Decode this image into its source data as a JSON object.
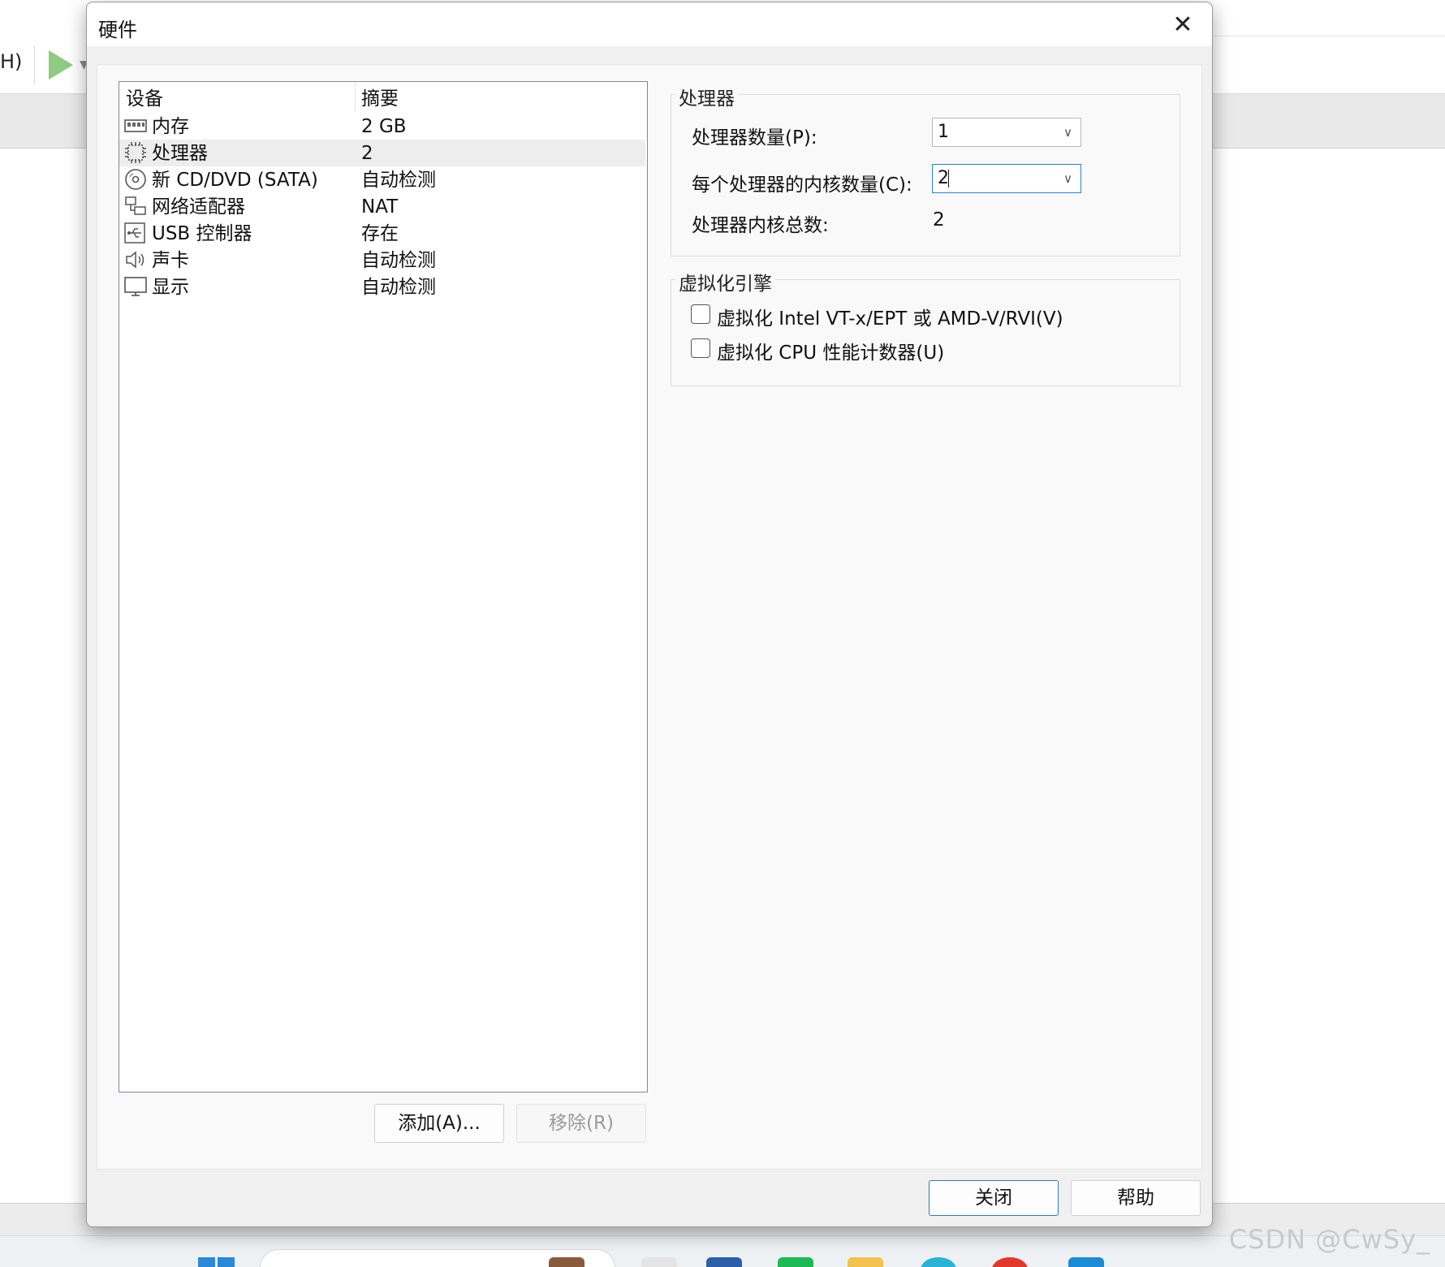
{
  "background": {
    "menu_fragment": "H)",
    "watermark": "CSDN @CwSy_"
  },
  "dialog": {
    "title": "硬件",
    "close_glyph": "✕"
  },
  "device_list": {
    "columns": {
      "device": "设备",
      "summary": "摘要"
    },
    "rows": [
      {
        "icon": "memory-icon",
        "name": "内存",
        "summary": "2 GB",
        "selected": false
      },
      {
        "icon": "processor-icon",
        "name": "处理器",
        "summary": "2",
        "selected": true
      },
      {
        "icon": "cd-dvd-icon",
        "name": "新 CD/DVD (SATA)",
        "summary": "自动检测",
        "selected": false
      },
      {
        "icon": "network-adapter-icon",
        "name": "网络适配器",
        "summary": "NAT",
        "selected": false
      },
      {
        "icon": "usb-icon",
        "name": "USB 控制器",
        "summary": "存在",
        "selected": false
      },
      {
        "icon": "speaker-icon",
        "name": "声卡",
        "summary": "自动检测",
        "selected": false
      },
      {
        "icon": "monitor-icon",
        "name": "显示",
        "summary": "自动检测",
        "selected": false
      }
    ],
    "add_button": "添加(A)...",
    "remove_button": "移除(R)"
  },
  "processor": {
    "group_title": "处理器",
    "count_label": "处理器数量(P):",
    "count_value": "1",
    "cores_label": "每个处理器的内核数量(C):",
    "cores_value": "2",
    "total_label": "处理器内核总数:",
    "total_value": "2"
  },
  "virtualization": {
    "group_title": "虚拟化引擎",
    "options": [
      {
        "label": "虚拟化 Intel VT-x/EPT 或 AMD-V/RVI(V)",
        "checked": false
      },
      {
        "label": "虚拟化 CPU 性能计数器(U)",
        "checked": false
      }
    ]
  },
  "footer": {
    "close_button": "关闭",
    "help_button": "帮助"
  },
  "colors": {
    "accent": "#2a7fd4",
    "play_green": "#8ecb7e",
    "selected_row": "#ededed"
  }
}
